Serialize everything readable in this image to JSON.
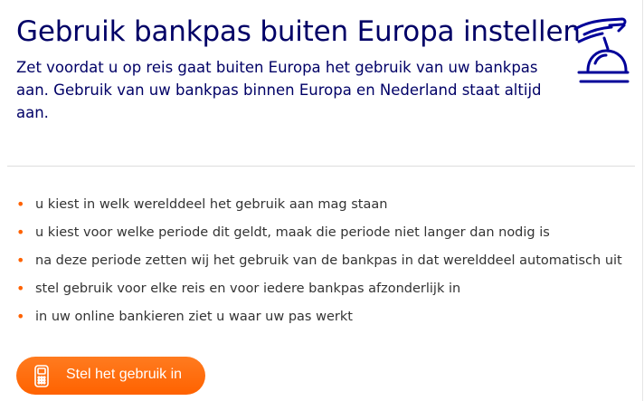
{
  "header": {
    "title": "Gebruik bankpas buiten Europa instellen",
    "intro": "Zet voordat u op reis gaat buiten Europa het gebruik van uw bankpas aan. Gebruik van uw bankpas binnen Europa en Nederland staat altijd aan.",
    "icon": "service-bell-icon"
  },
  "bullets": [
    "u kiest in welk werelddeel het gebruik aan mag staan",
    "u kiest voor welke periode dit geldt, maak die periode niet langer dan nodig is",
    "na deze periode zetten wij het gebruik van de bankpas in dat werelddeel automatisch uit",
    "stel gebruik voor elke reis en voor iedere bankpas afzonderlijk in",
    "in uw online bankieren ziet u waar uw pas werkt"
  ],
  "cta": {
    "label": "Stel het gebruik in",
    "icon": "phone-icon"
  },
  "colors": {
    "heading": "#000066",
    "accent": "#ff6200",
    "body_text": "#333333"
  }
}
